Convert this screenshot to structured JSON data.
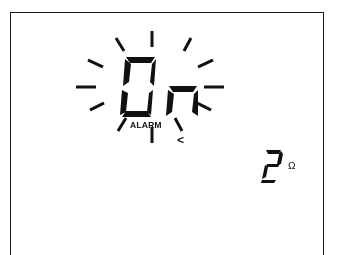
{
  "display": {
    "main_text": "On",
    "alarm_label": "ALARM",
    "unit_symbol": "Ω",
    "unit_value": "2",
    "indicator_glyph": "<"
  },
  "icons": {
    "blink": "blink-ray-icon",
    "indicator": "chevron-left-icon"
  },
  "colors": {
    "segment": "#111111",
    "background": "#ffffff"
  }
}
